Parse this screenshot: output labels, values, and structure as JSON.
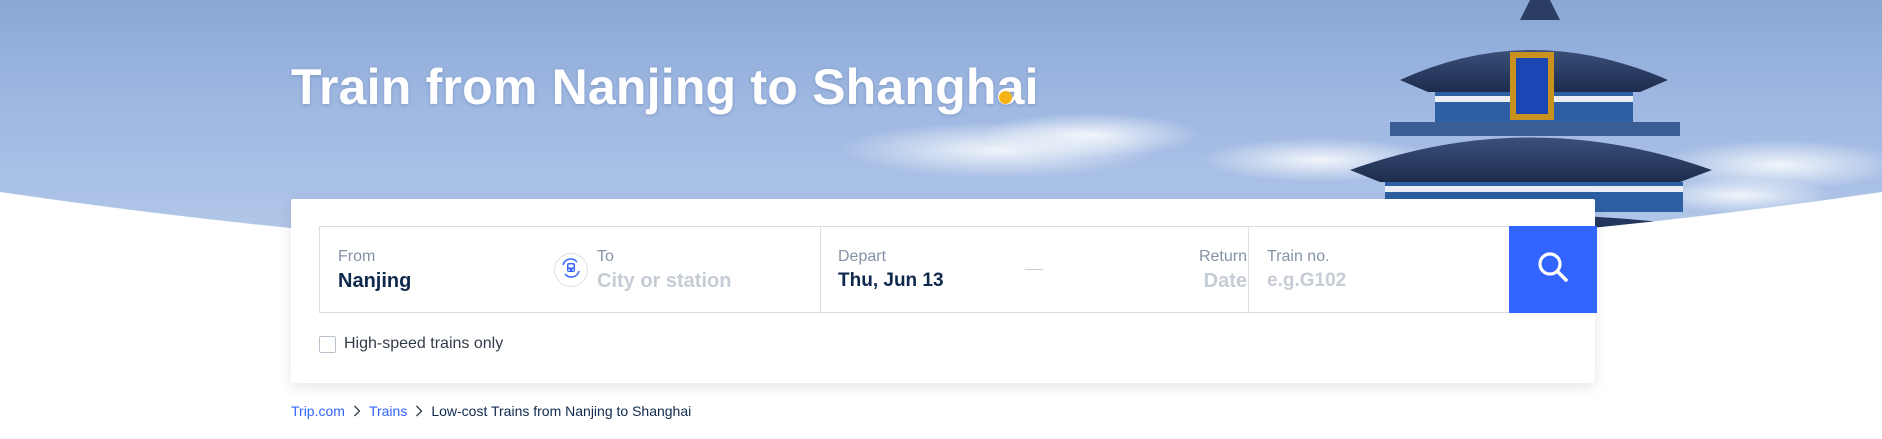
{
  "hero": {
    "title": "Train from Nanjing to Shanghai"
  },
  "search": {
    "from": {
      "label": "From",
      "value": "Nanjing"
    },
    "to": {
      "label": "To",
      "placeholder": "City or station"
    },
    "depart": {
      "label": "Depart",
      "value": "Thu, Jun 13"
    },
    "return": {
      "label": "Return",
      "placeholder": "Date"
    },
    "train_no": {
      "label": "Train no.",
      "placeholder": "e.g.G102"
    },
    "high_speed_only": {
      "label": "High-speed trains only",
      "checked": false
    }
  },
  "breadcrumb": {
    "items": [
      "Trip.com",
      "Trains",
      "Low-cost Trains from Nanjing to Shanghai"
    ]
  },
  "colors": {
    "accent": "#3264ff",
    "title_dot": "#f5b316",
    "text_dark": "#0f294d",
    "placeholder": "#c6ccd5",
    "label": "#8592a6"
  },
  "icons": [
    "train-swap-icon",
    "search-icon",
    "chevron-right-icon"
  ]
}
